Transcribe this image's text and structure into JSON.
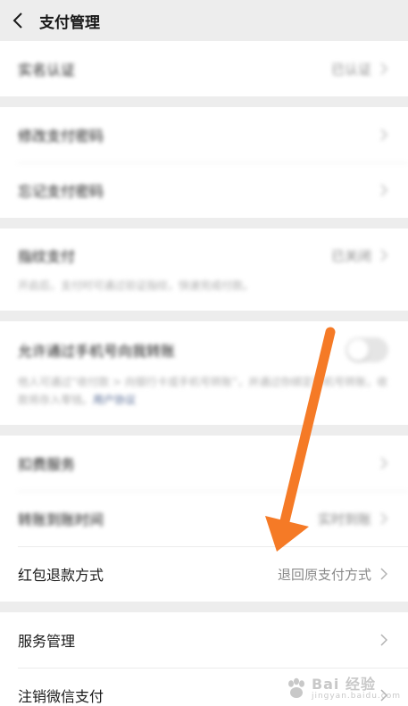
{
  "header": {
    "title": "支付管理"
  },
  "sections": [
    {
      "rows": [
        {
          "title": "实名认证",
          "value": "已认证"
        }
      ]
    },
    {
      "rows": [
        {
          "title": "修改支付密码"
        },
        {
          "title": "忘记支付密码"
        }
      ]
    },
    {
      "rows": [
        {
          "title": "指纹支付",
          "value": "已关闭",
          "desc": "开启后，支付时可通过验证指纹，快速完成付款。"
        }
      ]
    },
    {
      "rows": [
        {
          "title": "允许通过手机号向我转账",
          "toggle_on": false,
          "desc": "他人可通过“收付款 > 向银行卡或手机号转账”，并通过你绑定手机号转账，收款将存入零钱。",
          "link": "用户协议"
        }
      ]
    },
    {
      "rows": [
        {
          "title": "扣费服务"
        },
        {
          "title": "转账到账时间",
          "value": "实时到账"
        },
        {
          "title": "红包退款方式",
          "value": "退回原支付方式"
        }
      ]
    },
    {
      "rows": [
        {
          "title": "服务管理"
        },
        {
          "title": "注销微信支付"
        }
      ]
    }
  ],
  "annotation": {
    "arrow_color": "#f57a26"
  },
  "watermark": {
    "main": "Bai 经验",
    "sub": "jingyan.baidu.com"
  }
}
